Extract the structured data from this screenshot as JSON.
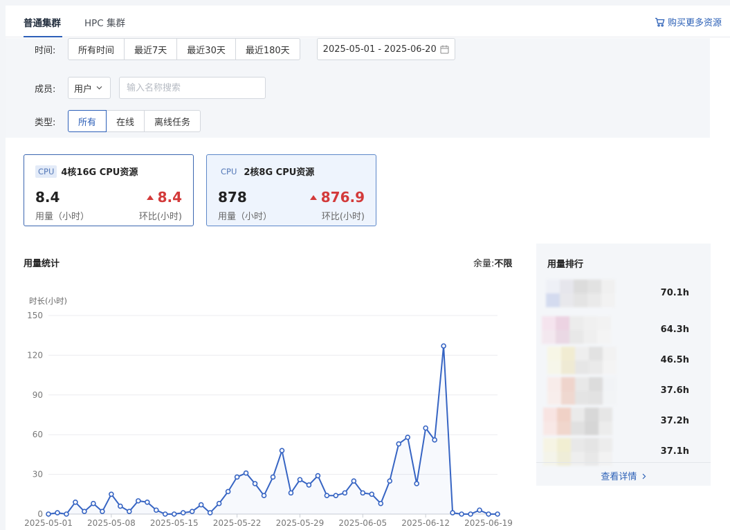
{
  "tabs": [
    {
      "label": "普通集群",
      "active": true
    },
    {
      "label": "HPC 集群",
      "active": false
    }
  ],
  "buy_more": {
    "label": "购买更多资源",
    "icon": "cart-icon"
  },
  "filters": {
    "time": {
      "label": "时间:",
      "options": [
        "所有时间",
        "最近7天",
        "最近30天",
        "最近180天"
      ],
      "date_range": "2025-05-01 - 2025-06-20"
    },
    "member": {
      "label": "成员:",
      "select_value": "用户",
      "search_placeholder": "输入名称搜索"
    },
    "type": {
      "label": "类型:",
      "options": [
        "所有",
        "在线",
        "离线任务"
      ],
      "selected": "所有"
    }
  },
  "resource_cards": [
    {
      "tag": "CPU",
      "title": "4核16G CPU资源",
      "usage": "8.4",
      "usage_label": "用量（小时）",
      "change": "8.4",
      "change_label": "环比(小时)",
      "selected": false
    },
    {
      "tag": "CPU",
      "title": "2核8G CPU资源",
      "usage": "878",
      "usage_label": "用量（小时）",
      "change": "876.9",
      "change_label": "环比(小时)",
      "selected": true
    }
  ],
  "usage_stats": {
    "title": "用量统计",
    "remaining_label": "余量:",
    "remaining_value": "不限"
  },
  "chart_data": {
    "type": "line",
    "ylabel": "时长(小时)",
    "ylim": [
      0,
      150
    ],
    "yticks": [
      0,
      30,
      60,
      90,
      120,
      150
    ],
    "xtick_labels": [
      "2025-05-01",
      "2025-05-08",
      "2025-05-15",
      "2025-05-22",
      "2025-05-29",
      "2025-06-05",
      "2025-06-12",
      "2025-06-19"
    ],
    "x_start": "2025-05-01",
    "x_end": "2025-06-20",
    "grid": true,
    "color": "#3664c3",
    "values": [
      0,
      1,
      0,
      9,
      2,
      8,
      2,
      15,
      6,
      2,
      10,
      9,
      3,
      0,
      0,
      1,
      2,
      7,
      1,
      8,
      17,
      28,
      31,
      23,
      14,
      28,
      48,
      16,
      26,
      22,
      29,
      14,
      14,
      16,
      25,
      16,
      15,
      8,
      25,
      53,
      58,
      23,
      65,
      56,
      127,
      1,
      0,
      0,
      3,
      0,
      0
    ]
  },
  "ranking": {
    "title": "用量排行",
    "items": [
      {
        "value": "70.1h",
        "colors": [
          "#eef0f6",
          "#e6e6ec",
          "#dcdcdc",
          "#e2e2e2",
          "#f0f0f0",
          "#d4dbef",
          "#e8e8ec",
          "#e4e4e4",
          "#eaeaea",
          "#f2f2f2"
        ]
      },
      {
        "value": "64.3h",
        "colors": [
          "#f5e4ee",
          "#ecd3e2",
          "#ececec",
          "#f0f0f0",
          "#f2f2f2",
          "#f3e8ef",
          "#ead8e4",
          "#e8e8e8",
          "#efefef",
          "#f4f4f4"
        ]
      },
      {
        "value": "46.5h",
        "colors": [
          "#f7f6e6",
          "#f1ecd2",
          "#eeeeee",
          "#e2e2e2",
          "#f2f2f2",
          "#f6f6ea",
          "#efead4",
          "#e6e6e6",
          "#eaeaea",
          "#f4f4f4"
        ]
      },
      {
        "value": "37.6h",
        "colors": [
          "#f8ecea",
          "#efd4cc",
          "#e8e8e8",
          "#dcdcdc",
          "#f1f3f6",
          "#f8eeec",
          "#efd8d0",
          "#e4e4e4",
          "#e2e2e2",
          "#f2f4f6"
        ]
      },
      {
        "value": "37.2h",
        "colors": [
          "#f8e4e2",
          "#f0d1c6",
          "#eaeaea",
          "#d8d8d8",
          "#e6e6e6",
          "#f8e8e6",
          "#f0d6cc",
          "#e0e0e0",
          "#d6d6d6",
          "#ececec"
        ]
      },
      {
        "value": "37.1h",
        "colors": [
          "#f6f4e4",
          "#f1eed2",
          "#e8e8e8",
          "#e4e4e4",
          "#ececec",
          "#f4f4ea",
          "#efedd8",
          "#eeeeee",
          "#e8e8e8",
          "#f2f2f2"
        ]
      }
    ],
    "more_label": "查看详情"
  }
}
